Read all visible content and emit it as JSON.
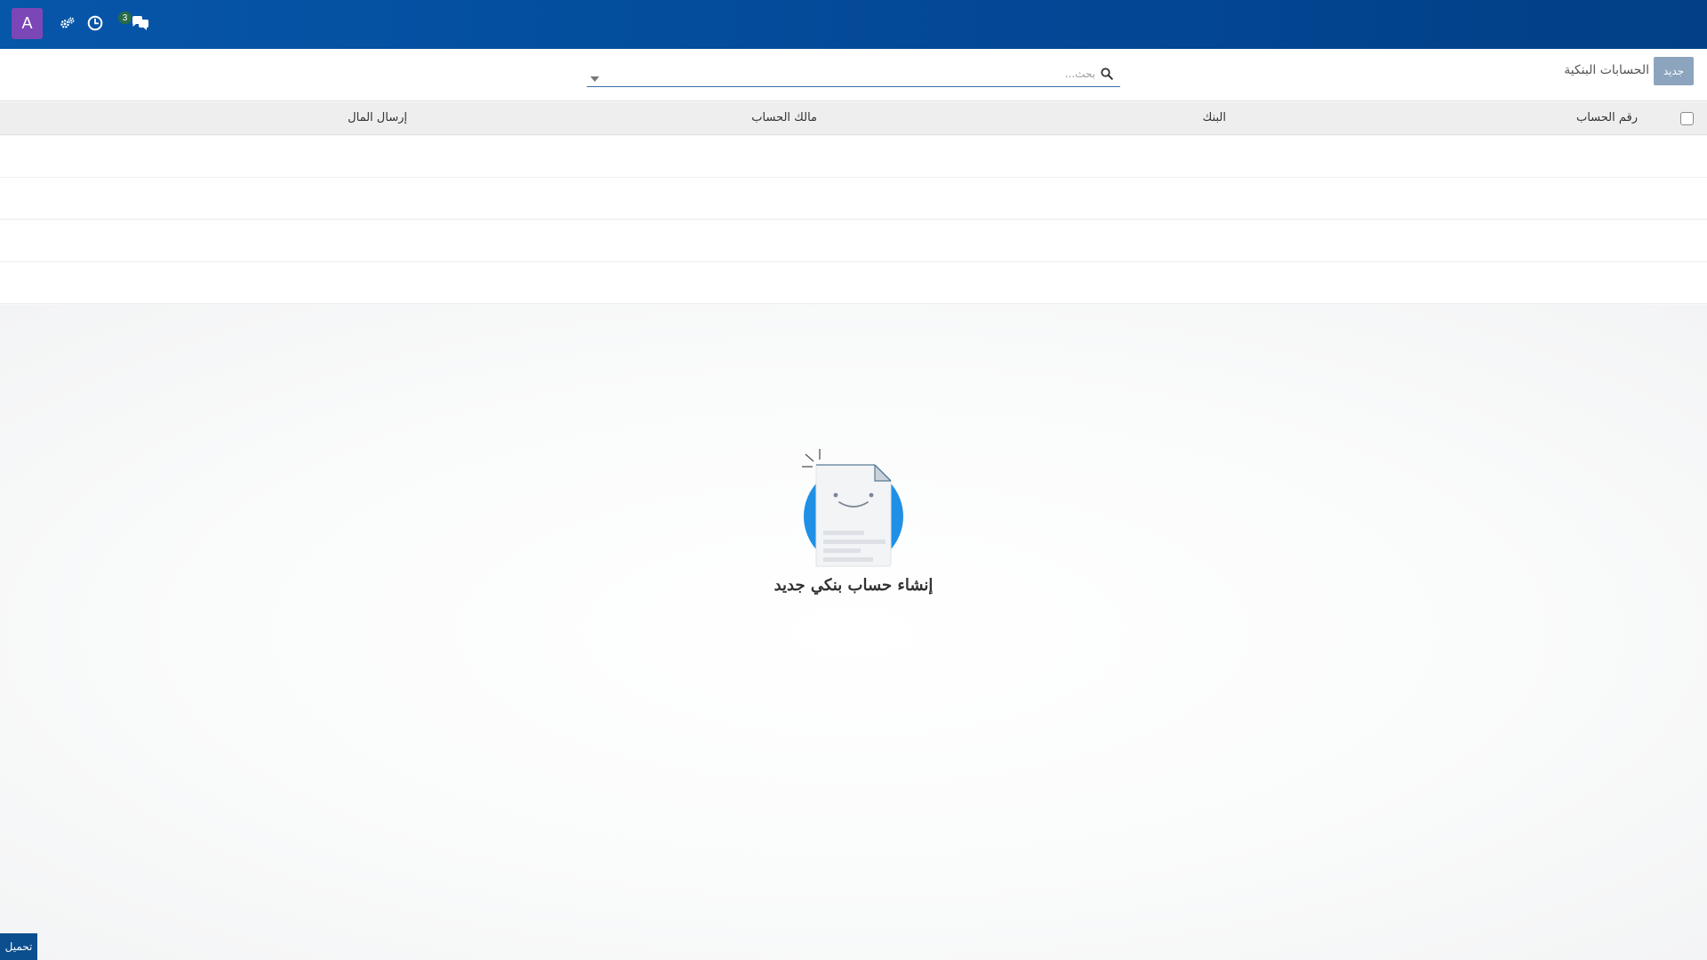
{
  "navbar": {
    "avatar_letter": "A",
    "icons": [
      "gears-icon",
      "clock-icon",
      "comments-icon"
    ],
    "notification_count": "3"
  },
  "control_panel": {
    "new_button_label": "جديد",
    "breadcrumb": "الحسابات البنكية",
    "search_placeholder": "بحث..."
  },
  "table": {
    "columns": [
      "رقم الحساب",
      "البنك",
      "مالك الحساب",
      "إرسال المال"
    ]
  },
  "empty_state": {
    "title": "إنشاء حساب بنكي جديد"
  },
  "footer": {
    "download_label": "تحميل"
  },
  "colors": {
    "navbar": "#034896",
    "avatar": "#7b46b6",
    "badge": "#2a6a47",
    "new_button": "#8ca4bd",
    "illustration_blue": "#1f90e6"
  }
}
